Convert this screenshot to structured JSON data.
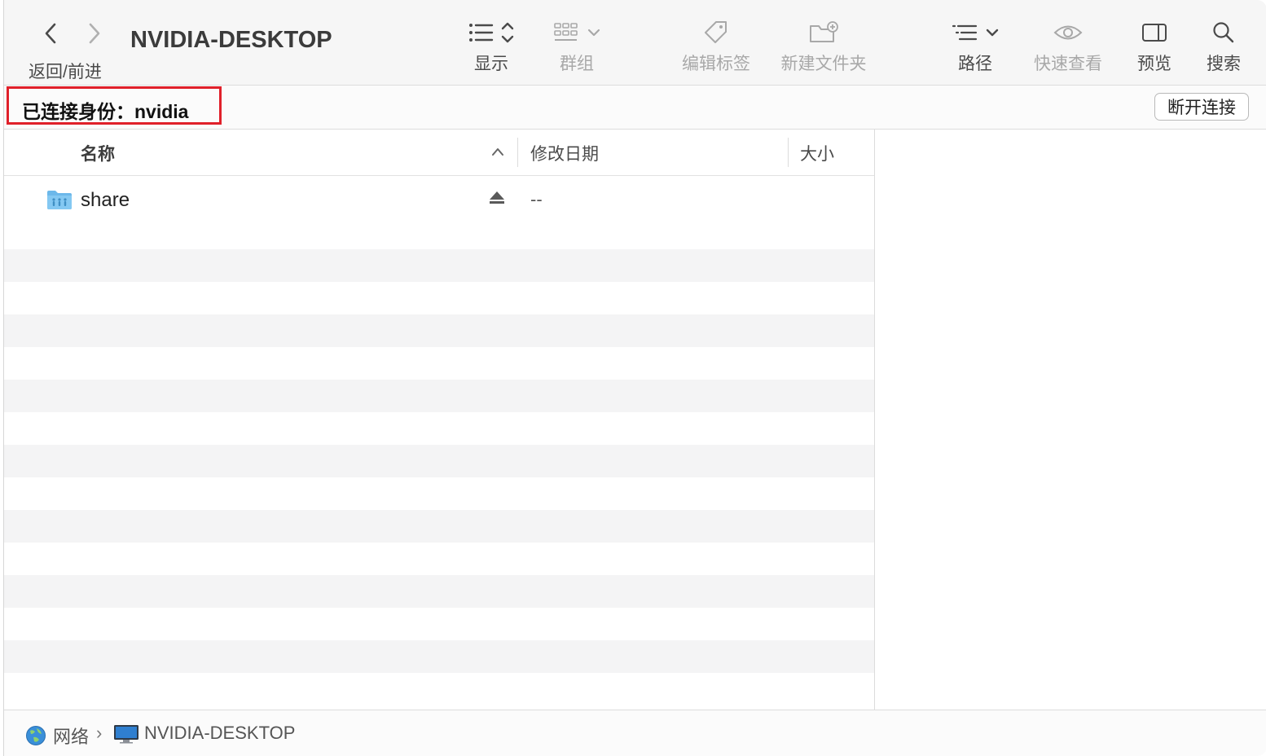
{
  "toolbar": {
    "title": "NVIDIA-DESKTOP",
    "nav_label": "返回/前进",
    "display_label": "显示",
    "group_label": "群组",
    "edit_tags_label": "编辑标签",
    "new_folder_label": "新建文件夹",
    "path_label": "路径",
    "quicklook_label": "快速查看",
    "preview_label": "预览",
    "search_label": "搜索"
  },
  "connection": {
    "status_text": "已连接身份：nvidia",
    "disconnect_label": "断开连接"
  },
  "columns": {
    "name": "名称",
    "date": "修改日期",
    "size": "大小"
  },
  "files": [
    {
      "name": "share",
      "modified": "--",
      "icon": "shared-folder-icon"
    }
  ],
  "pathbar": {
    "network": "网络",
    "separator": "›",
    "host": "NVIDIA-DESKTOP"
  },
  "colors": {
    "highlight_border": "#e0202a",
    "folder_blue": "#6cb8ea"
  }
}
